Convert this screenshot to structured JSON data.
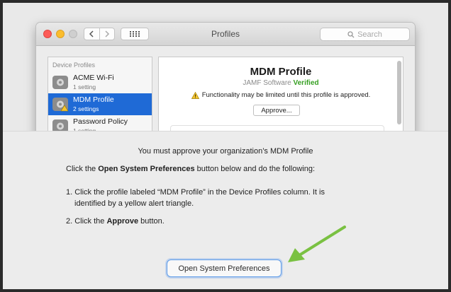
{
  "window": {
    "title": "Profiles",
    "search_placeholder": "Search",
    "icons": {
      "back": "chevron-left-icon",
      "forward": "chevron-right-icon",
      "grid": "grid-icon",
      "search": "search-icon"
    }
  },
  "sidebar": {
    "heading": "Device Profiles",
    "items": [
      {
        "name": "ACME Wi-Fi",
        "sub": "1 setting",
        "selected": false
      },
      {
        "name": "MDM Profile",
        "sub": "2 settings",
        "selected": true
      },
      {
        "name": "Password Policy",
        "sub": "1 setting",
        "selected": false
      }
    ]
  },
  "detail": {
    "title": "MDM Profile",
    "vendor": "JAMF Software",
    "verified": "Verified",
    "warning": "Functionality may be limited until this profile is approved.",
    "approve_button": "Approve..."
  },
  "sheet": {
    "heading": "You must approve your organization’s MDM Profile",
    "instruction_prefix": "Click the ",
    "instruction_bold": "Open System Preferences",
    "instruction_suffix": " button below and do the following:",
    "step1_line1": "1. Click the profile labeled “MDM Profile” in the Device Profiles column. It is",
    "step1_line2": "identified by a yellow alert triangle.",
    "step2_prefix": "2. Click the ",
    "step2_bold": "Approve",
    "step2_suffix": " button.",
    "button": "Open System Preferences"
  },
  "colors": {
    "selection": "#1f6ad6",
    "verified": "#37a023",
    "arrow": "#7ac142",
    "button_border": "#5b9ae8"
  }
}
